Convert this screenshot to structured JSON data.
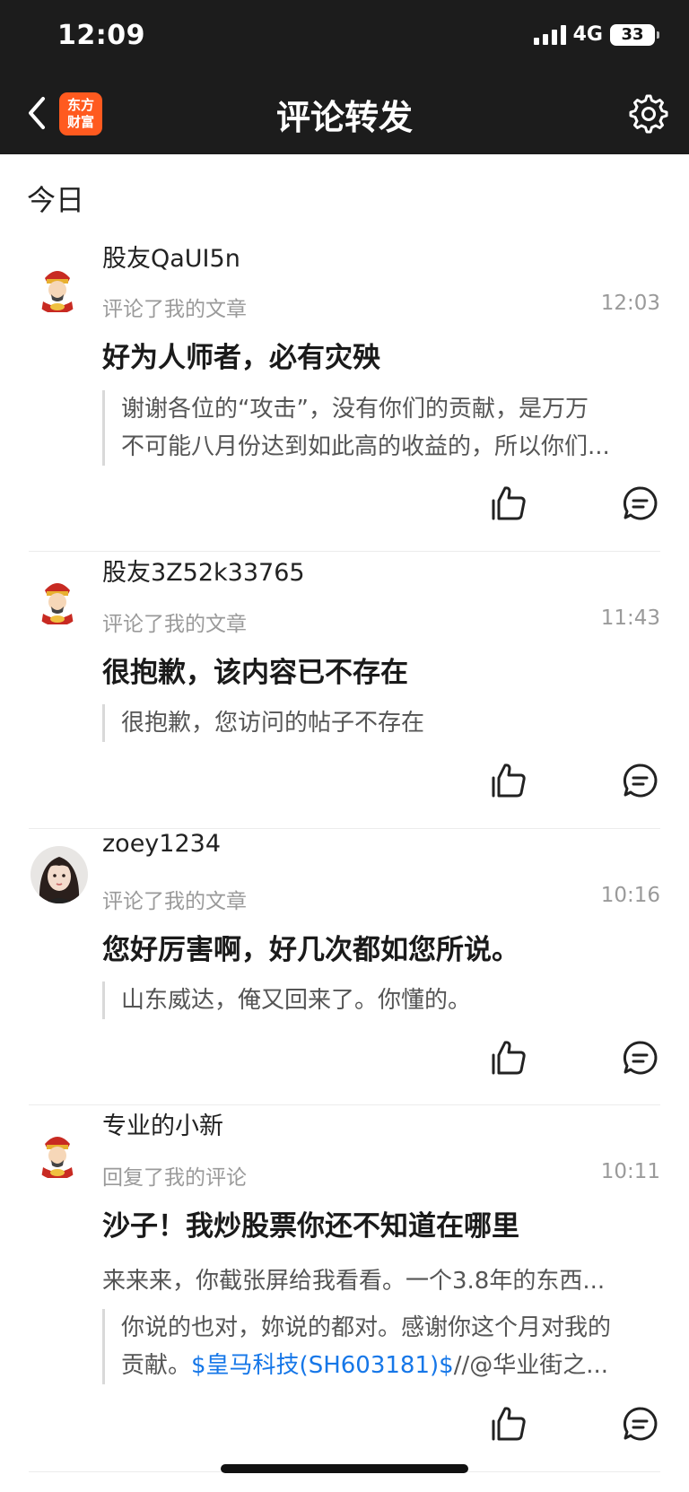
{
  "status_bar": {
    "time": "12:09",
    "network": "4G",
    "battery": "33"
  },
  "nav": {
    "logo_line1": "东方",
    "logo_line2": "财富",
    "title": "评论转发"
  },
  "section": {
    "today": "今日"
  },
  "items": [
    {
      "username": "股友QaUI5n",
      "action": "评论了我的文章",
      "time": "12:03",
      "headline": "好为人师者，必有灾殃",
      "quote_line1": "谢谢各位的“攻击”，没有你们的贡献，是万万",
      "quote_line2": "不可能八月份达到如此高的收益的，所以你们..."
    },
    {
      "username": "股友3Z52k33765",
      "action": "评论了我的文章",
      "time": "11:43",
      "headline": "很抱歉，该内容已不存在",
      "quote_line1": "很抱歉，您访问的帖子不存在"
    },
    {
      "username": "zoey1234",
      "action": "评论了我的文章",
      "time": "10:16",
      "headline": "您好厉害啊，好几次都如您所说。",
      "quote_line1": "山东威达，俺又回来了。你懂的。"
    },
    {
      "username": "专业的小新",
      "action": "回复了我的评论",
      "time": "10:11",
      "headline": "沙子！我炒股票你还不知道在哪里",
      "reply_preview": "来来来，你截张屏给我看看。一个3.8年的东西...",
      "quote_line1": "你说的也对，妳说的都对。感谢你这个月对我的",
      "quote_line2_pre": "贡献。",
      "quote_line2_link": "$皇马科技(SH603181)$",
      "quote_line2_post": "//@华业街之..."
    }
  ],
  "icons": {
    "back": "chevron-left-icon",
    "settings": "gear-icon",
    "like": "thumbs-up-icon",
    "comment": "comment-bubble-icon"
  },
  "colors": {
    "brand": "#ff5a1f",
    "link": "#1677e8",
    "header_bg": "#1c1c1c"
  }
}
